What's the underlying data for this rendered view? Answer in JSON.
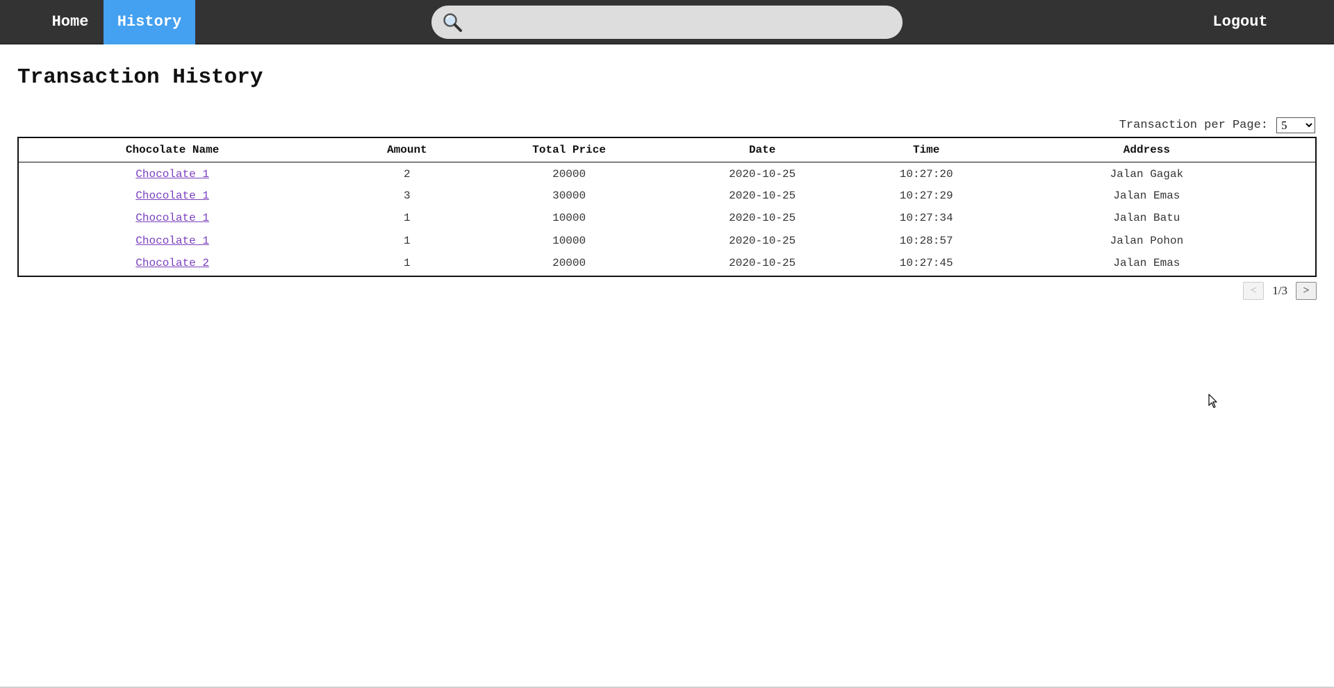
{
  "nav": {
    "home_label": "Home",
    "history_label": "History",
    "logout_label": "Logout",
    "active_item": "History",
    "active_color": "#44a0f0",
    "bar_color": "#333333"
  },
  "search": {
    "icon": "search-icon",
    "value": "",
    "placeholder": ""
  },
  "page": {
    "title": "Transaction History"
  },
  "per_page": {
    "label": "Transaction per Page:",
    "selected": "5",
    "options": [
      "5"
    ]
  },
  "table": {
    "columns": [
      "Chocolate Name",
      "Amount",
      "Total Price",
      "Date",
      "Time",
      "Address"
    ],
    "rows": [
      {
        "name": "Chocolate 1",
        "amount": "2",
        "total": "20000",
        "date": "2020-10-25",
        "time": "10:27:20",
        "address": "Jalan Gagak"
      },
      {
        "name": "Chocolate 1",
        "amount": "3",
        "total": "30000",
        "date": "2020-10-25",
        "time": "10:27:29",
        "address": "Jalan Emas"
      },
      {
        "name": "Chocolate 1",
        "amount": "1",
        "total": "10000",
        "date": "2020-10-25",
        "time": "10:27:34",
        "address": "Jalan Batu"
      },
      {
        "name": "Chocolate 1",
        "amount": "1",
        "total": "10000",
        "date": "2020-10-25",
        "time": "10:28:57",
        "address": "Jalan Pohon"
      },
      {
        "name": "Chocolate 2",
        "amount": "1",
        "total": "20000",
        "date": "2020-10-25",
        "time": "10:27:45",
        "address": "Jalan Emas"
      }
    ],
    "link_color": "#7a3fbf"
  },
  "pagination": {
    "prev_label": "<",
    "next_label": ">",
    "page_indicator": "1/3",
    "prev_disabled": true
  }
}
